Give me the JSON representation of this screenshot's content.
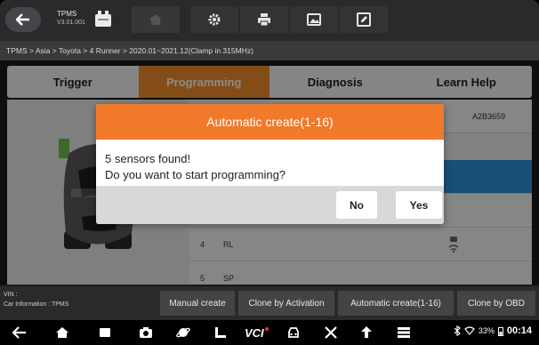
{
  "toolbar": {
    "app_title": "TPMS",
    "app_version": "V3.01.001"
  },
  "breadcrumb": "TPMS > Asia > Toyota > 4 Runner > 2020.01~2021.12(Clamp in 315MHz)",
  "tabs": [
    {
      "label": "Trigger"
    },
    {
      "label": "Programming"
    },
    {
      "label": "Diagnosis"
    },
    {
      "label": "Learn Help"
    }
  ],
  "table": {
    "rows": [
      {
        "num": "",
        "pos": "",
        "id": "A2B3659"
      },
      {
        "num": "",
        "pos": "",
        "id": ""
      },
      {
        "num": "",
        "pos": "",
        "id": ""
      },
      {
        "num": "4",
        "pos": "RL",
        "id": ""
      },
      {
        "num": "5",
        "pos": "SP",
        "id": ""
      }
    ]
  },
  "dialog": {
    "title": "Automatic create(1-16)",
    "line1": "5 sensors found!",
    "line2": "Do you want to start programming?",
    "no_label": "No",
    "yes_label": "Yes"
  },
  "funcbar": {
    "vin": "VIN :",
    "car_info": "Car Information : TPMS",
    "buttons": [
      {
        "label": "Manual create"
      },
      {
        "label": "Clone by Activation"
      },
      {
        "label": "Automatic create(1-16)"
      },
      {
        "label": "Clone by OBD"
      }
    ]
  },
  "status": {
    "battery": "33%",
    "time": "00:14",
    "vci_label": "VCI"
  },
  "colors": {
    "accent": "#f07a2a",
    "selected_row": "#2f8fd8"
  }
}
